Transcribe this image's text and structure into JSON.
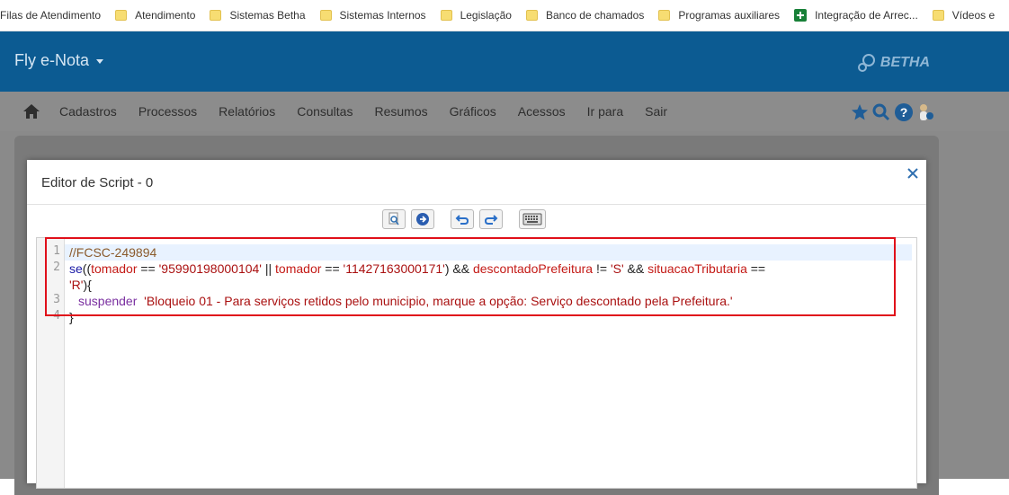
{
  "bookmarks": [
    {
      "label": "Filas de Atendimento",
      "icon": "folder-icon"
    },
    {
      "label": "Atendimento",
      "icon": "folder-icon"
    },
    {
      "label": "Sistemas Betha",
      "icon": "folder-icon"
    },
    {
      "label": "Sistemas Internos",
      "icon": "folder-icon"
    },
    {
      "label": "Legislação",
      "icon": "folder-icon"
    },
    {
      "label": "Banco de chamados",
      "icon": "folder-icon"
    },
    {
      "label": "Programas auxiliares",
      "icon": "folder-icon"
    },
    {
      "label": "Integração de Arrec...",
      "icon": "sheets-icon"
    },
    {
      "label": "Vídeos e",
      "icon": "folder-icon"
    }
  ],
  "header": {
    "app_title": "Fly e-Nota",
    "brand": "BETHA"
  },
  "nav": {
    "items": [
      "Cadastros",
      "Processos",
      "Relatórios",
      "Consultas",
      "Resumos",
      "Gráficos",
      "Acessos",
      "Ir para",
      "Sair"
    ]
  },
  "modal": {
    "title": "Editor de Script - 0"
  },
  "editor": {
    "line_numbers": [
      "1",
      "2",
      "3",
      "4"
    ],
    "line1_comment": "//FCSC-249894",
    "l2_se": "se",
    "l2_p1": "((",
    "l2_tomador1": "tomador",
    "l2_eq1": " == ",
    "l2_str1": "'95990198000104'",
    "l2_or": " || ",
    "l2_tomador2": "tomador",
    "l2_eq2": " == ",
    "l2_str2": "'11427163000171'",
    "l2_and1": ") && ",
    "l2_desc": "descontadoPrefeitura",
    "l2_neq": " != ",
    "l2_str3": "'S'",
    "l2_and2": " && ",
    "l2_sit": "situacaoTributaria",
    "l2_eq3": " ==",
    "l2b_str4": "'R'",
    "l2b_close": "){",
    "l3_fn": "suspender",
    "l3_str": "'Bloqueio 01 - Para serviços retidos pelo municipio, marque a opção: Serviço descontado pela Prefeitura.'",
    "l4_close": "}"
  }
}
